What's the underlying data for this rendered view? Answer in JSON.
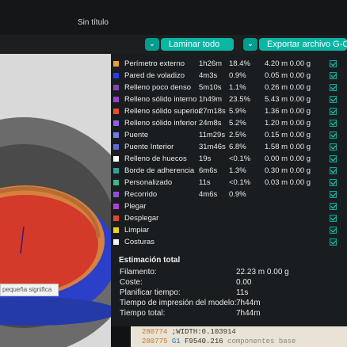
{
  "window": {
    "title": "Sin título"
  },
  "toolbar": {
    "slice_label": "Laminar todo",
    "export_label": "Exportar archivo G-Code",
    "dropdown_glyph": "⌄"
  },
  "viewport": {
    "tooltip": "pequeña significa"
  },
  "features": [
    {
      "name": "Perímetro externo",
      "time": "1h26m",
      "percent": "18.4%",
      "usage": "4.20 m  0.00 g",
      "color": "#f39a36"
    },
    {
      "name": "Pared de voladizo",
      "time": "4m3s",
      "percent": "0.9%",
      "usage": "0.05 m  0.00 g",
      "color": "#2c3cf4"
    },
    {
      "name": "Relleno poco denso",
      "time": "5m10s",
      "percent": "1.1%",
      "usage": "0.26 m  0.00 g",
      "color": "#8d3fb8"
    },
    {
      "name": "Relleno sólido interno",
      "time": "1h49m",
      "percent": "23.5%",
      "usage": "5.43 m  0.00 g",
      "color": "#9b3fd2"
    },
    {
      "name": "Relleno sólido superior",
      "time": "27m18s",
      "percent": "5.9%",
      "usage": "1.36 m  0.00 g",
      "color": "#e8502c"
    },
    {
      "name": "Relleno sólido inferior",
      "time": "24m8s",
      "percent": "5.2%",
      "usage": "1.20 m  0.00 g",
      "color": "#8f5fe6"
    },
    {
      "name": "Puente",
      "time": "11m29s",
      "percent": "2.5%",
      "usage": "0.15 m  0.00 g",
      "color": "#6a7ef0"
    },
    {
      "name": "Puente Interior",
      "time": "31m46s",
      "percent": "6.8%",
      "usage": "1.58 m  0.00 g",
      "color": "#5a6ae0"
    },
    {
      "name": "Relleno de huecos",
      "time": "19s",
      "percent": "<0.1%",
      "usage": "0.00 m  0.00 g",
      "color": "#ffffff"
    },
    {
      "name": "Borde de adherencia",
      "time": "6m6s",
      "percent": "1.3%",
      "usage": "0.30 m  0.00 g",
      "color": "#2fa39a"
    },
    {
      "name": "Personalizado",
      "time": "11s",
      "percent": "<0.1%",
      "usage": "0.03 m  0.00 g",
      "color": "#3cb58a"
    },
    {
      "name": "Recorrido",
      "time": "4m6s",
      "percent": "0.9%",
      "usage": "",
      "color": "#8f4fd0"
    },
    {
      "name": "Plegar",
      "time": "",
      "percent": "",
      "usage": "",
      "color": "#b03fd8"
    },
    {
      "name": "Desplegar",
      "time": "",
      "percent": "",
      "usage": "",
      "color": "#e04a2a"
    },
    {
      "name": "Limpiar",
      "time": "",
      "percent": "",
      "usage": "",
      "color": "#f0d020"
    },
    {
      "name": "Costuras",
      "time": "",
      "percent": "",
      "usage": "",
      "color": "#f4f4f4"
    }
  ],
  "estimate": {
    "title": "Estimación total",
    "rows": [
      {
        "label": "Filamento:",
        "value": "22.23 m   0.00 g"
      },
      {
        "label": "Coste:",
        "value": "0.00"
      },
      {
        "label": "Planificar tiempo:",
        "value": "11s"
      },
      {
        "label": "Tiempo de impresión del modelo:",
        "value": "7h44m"
      },
      {
        "label": "Tiempo total:",
        "value": "7h44m"
      }
    ]
  },
  "gcode": {
    "lines": [
      {
        "num": "280774",
        "cmd": "",
        "text": ";WIDTH:0.103914",
        "faint": ""
      },
      {
        "num": "280775",
        "cmd": "G1",
        "text": "F9540.216",
        "faint": "componentes base"
      }
    ]
  },
  "colors": {
    "accent": "#0ab6a4",
    "panel_bg": "#1a1d1f",
    "viewport_bg": "#d9d9d9"
  }
}
